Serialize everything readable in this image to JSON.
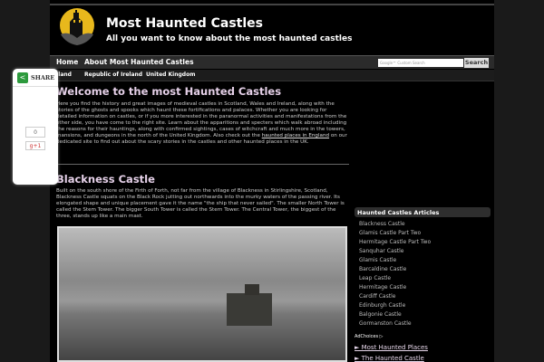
{
  "header": {
    "title": "Most Haunted Castles",
    "tagline": "All you want to know about the most haunted castles"
  },
  "nav": {
    "items": [
      "Home",
      "About Most Haunted Castles"
    ],
    "search_placeholder": "Google™ Custom Search",
    "search_button": "Search"
  },
  "subnav": {
    "items": [
      "Ireland",
      "Republic of Ireland",
      "United Kingdom"
    ]
  },
  "welcome": {
    "heading": "Welcome to the most Haunted Castles",
    "text_before": "Here you find the history and great images of medieval castles in Scotland, Wales and Ireland, along with the stories of the ghosts and spooks which haunt these fortifications and palaces. Whether you are looking for detailed information on castles, or if you more interested in the paranormal activities and manifestations from the other side, you have come to the right site. Learn about the apparitions and specters which walk abroad including the reasons for their hauntings, along with confirmed sightings, cases of witchcraft and much more in the towers, mansions, and dungeons in the north of the United Kingdom. Also check out the ",
    "link": "haunted places in England",
    "text_after": " on our dedicated site to find out about the scary stories in the castles and other haunted places in the UK."
  },
  "article": {
    "heading": "Blackness Castle",
    "text": "Built on the south shore of the Firth of Forth, not far from the village of Blackness in Stirlingshire, Scotland, Blackness Castle squats on the Black Rock jutting out northwards into the murky waters of the passing river. Its elongated shape and unique placement gave it the name \"the ship that never sailed\". The smaller North Tower is called the Stem Tower. The bigger South Tower is called the Stern Tower. The Central Tower, the biggest of the three, stands up like a main mast."
  },
  "sidebar": {
    "heading": "Haunted Castles Articles",
    "items": [
      "Blackness Castle",
      "Glamis Castle Part Two",
      "Hermitage Castle Part Two",
      "Sanquhar Castle",
      "Glamis Castle",
      "Barcaldine Castle",
      "Leap Castle",
      "Hermitage Castle",
      "Cardiff Castle",
      "Edinburgh Castle",
      "Balgonie Castle",
      "Gormanston Castle"
    ],
    "adchoices": "AdChoices ▷",
    "ad_links": [
      "► Most Haunted Places",
      "► The Haunted Castle"
    ]
  },
  "share": {
    "label": "SHARE",
    "count": "0",
    "gplus": "g+1"
  }
}
